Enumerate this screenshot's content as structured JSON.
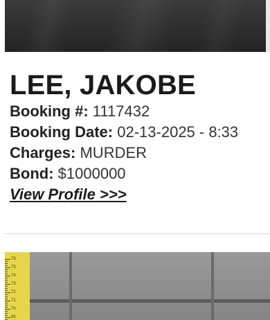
{
  "inmate": {
    "name": "LEE, JAKOBE",
    "booking_number_label": "Booking #:",
    "booking_number": "1117432",
    "booking_date_label": "Booking Date:",
    "booking_date": "02-13-2025 - 8:33",
    "charges_label": "Charges:",
    "charges": "MURDER",
    "bond_label": "Bond:",
    "bond": "$1000000",
    "profile_link": "View Profile >>>"
  },
  "next_photo": {
    "ruler_marks": [
      "76",
      "75",
      "74",
      "73",
      "72",
      "71",
      "70",
      "69"
    ]
  }
}
